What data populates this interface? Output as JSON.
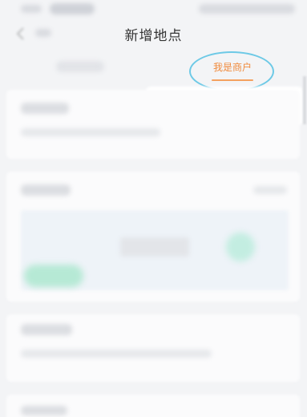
{
  "header": {
    "title": "新增地点",
    "back_icon": "chevron-left-icon"
  },
  "tabs": {
    "merchant_label": "我是商户",
    "active_color": "#f08a3c"
  },
  "annotation": {
    "highlight_color": "#6dc9e6"
  }
}
